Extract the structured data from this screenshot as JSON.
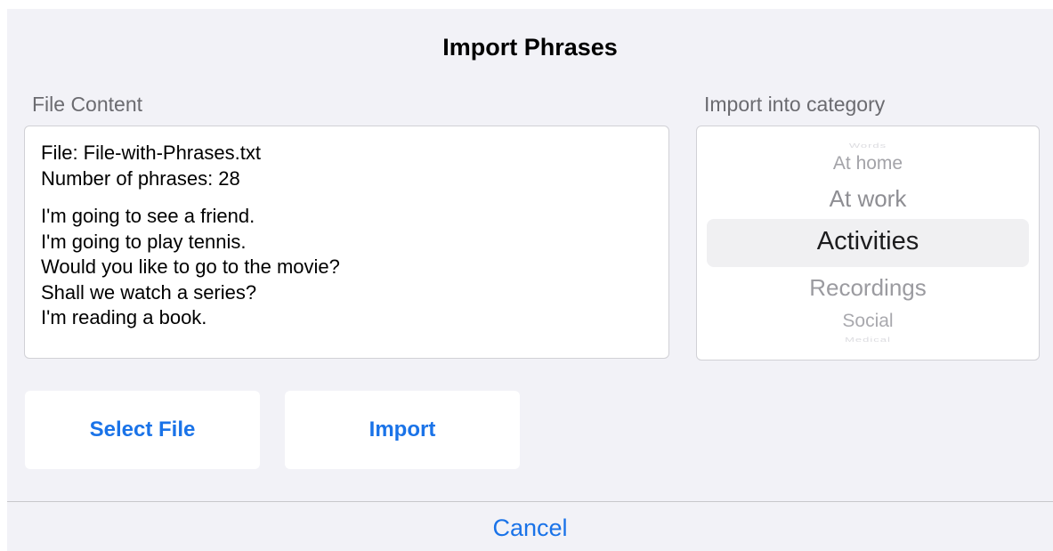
{
  "dialog": {
    "title": "Import Phrases",
    "cancel_label": "Cancel"
  },
  "file_content": {
    "label": "File Content",
    "file_line": "File: File-with-Phrases.txt",
    "count_line": "Number of phrases: 28",
    "phrases": [
      "I'm going to see a friend.",
      "I'm going to play tennis.",
      "Would you like to go to the movie?",
      "Shall we watch a series?",
      "I'm reading a book."
    ]
  },
  "category_picker": {
    "label": "Import into category",
    "items": [
      "Words",
      "At home",
      "At work",
      "Activities",
      "Recordings",
      "Social",
      "Medical"
    ],
    "selected": "Activities"
  },
  "buttons": {
    "select_file": "Select File",
    "import": "Import"
  },
  "colors": {
    "accent": "#1a73e8",
    "background": "#f2f2f7"
  }
}
